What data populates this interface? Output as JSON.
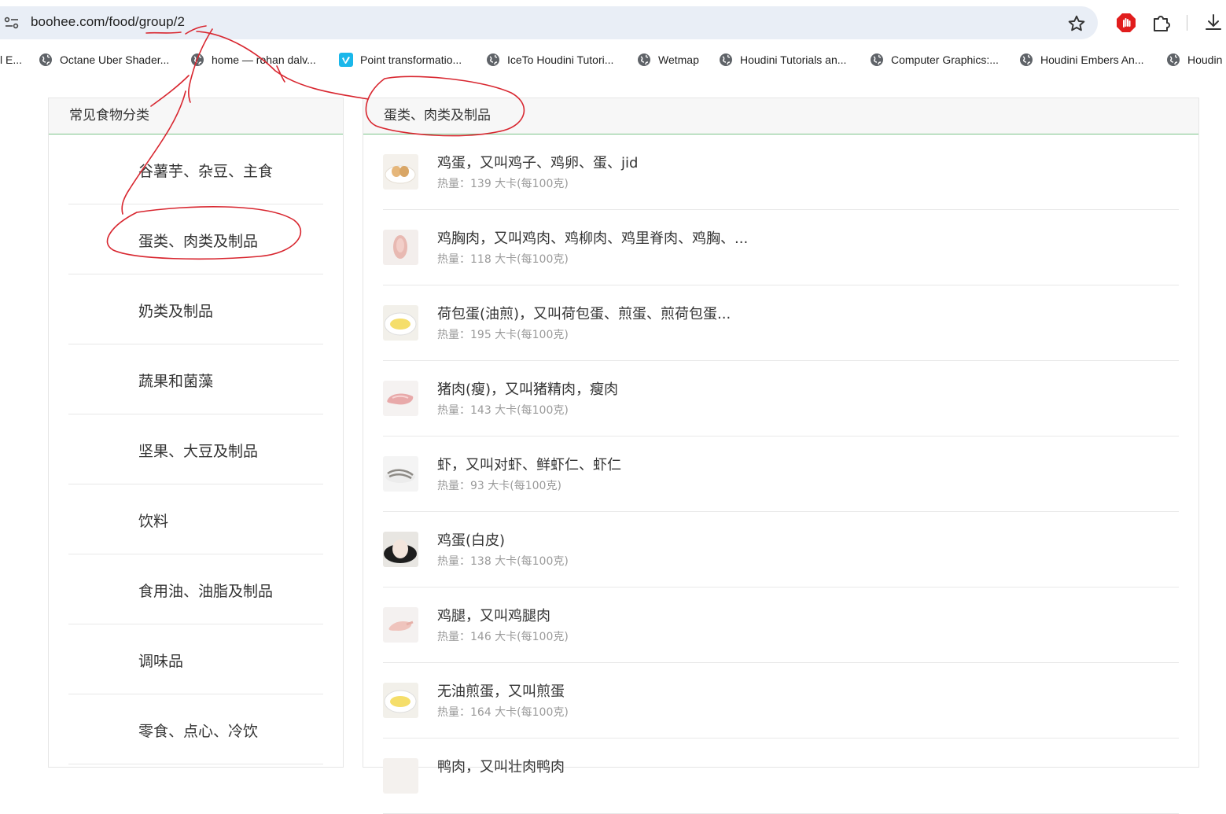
{
  "browser": {
    "url": "boohee.com/food/group/2",
    "icons": [
      "site-info-icon",
      "star-icon",
      "stop-hand-icon",
      "puzzle-icon",
      "download-icon"
    ]
  },
  "bookmarks": [
    {
      "label": "l E..."
    },
    {
      "label": "Octane Uber Shader..."
    },
    {
      "label": "home — rohan dalv..."
    },
    {
      "label": "Point transformatio..."
    },
    {
      "label": "IceTo Houdini Tutori..."
    },
    {
      "label": "Wetmap"
    },
    {
      "label": "Houdini Tutorials an..."
    },
    {
      "label": "Computer Graphics:..."
    },
    {
      "label": "Houdini Embers An..."
    },
    {
      "label": "Houdin"
    }
  ],
  "sidebar": {
    "title": "常见食物分类",
    "items": [
      {
        "label": "谷薯芋、杂豆、主食"
      },
      {
        "label": "蛋类、肉类及制品"
      },
      {
        "label": "奶类及制品"
      },
      {
        "label": "蔬果和菌藻"
      },
      {
        "label": "坚果、大豆及制品"
      },
      {
        "label": "饮料"
      },
      {
        "label": "食用油、油脂及制品"
      },
      {
        "label": "调味品"
      },
      {
        "label": "零食、点心、冷饮"
      }
    ]
  },
  "main": {
    "title": "蛋类、肉类及制品",
    "foods": [
      {
        "name": "鸡蛋，又叫鸡子、鸡卵、蛋、jid",
        "calories": "热量：139 大卡(每100克)",
        "thumb": "egg"
      },
      {
        "name": "鸡胸肉，又叫鸡肉、鸡柳肉、鸡里脊肉、鸡胸、...",
        "calories": "热量：118 大卡(每100克)",
        "thumb": "chicken"
      },
      {
        "name": "荷包蛋(油煎)，又叫荷包蛋、煎蛋、煎荷包蛋...",
        "calories": "热量：195 大卡(每100克)",
        "thumb": "fried-egg"
      },
      {
        "name": "猪肉(瘦)，又叫猪精肉，瘦肉",
        "calories": "热量：143 大卡(每100克)",
        "thumb": "pork"
      },
      {
        "name": "虾，又叫对虾、鲜虾仁、虾仁",
        "calories": "热量：93 大卡(每100克)",
        "thumb": "shrimp"
      },
      {
        "name": "鸡蛋(白皮)",
        "calories": "热量：138 大卡(每100克)",
        "thumb": "white-egg"
      },
      {
        "name": "鸡腿，又叫鸡腿肉",
        "calories": "热量：146 大卡(每100克)",
        "thumb": "chicken-leg"
      },
      {
        "name": "无油煎蛋，又叫煎蛋",
        "calories": "热量：164 大卡(每100克)",
        "thumb": "fried-egg"
      },
      {
        "name": "鸭肉，又叫壮肉鸭肉",
        "calories": "",
        "thumb": "duck"
      }
    ]
  },
  "colors": {
    "header_underline": "#7bc48a",
    "annotation": "#d8262f",
    "omnibox_bg": "#e9eef6"
  }
}
